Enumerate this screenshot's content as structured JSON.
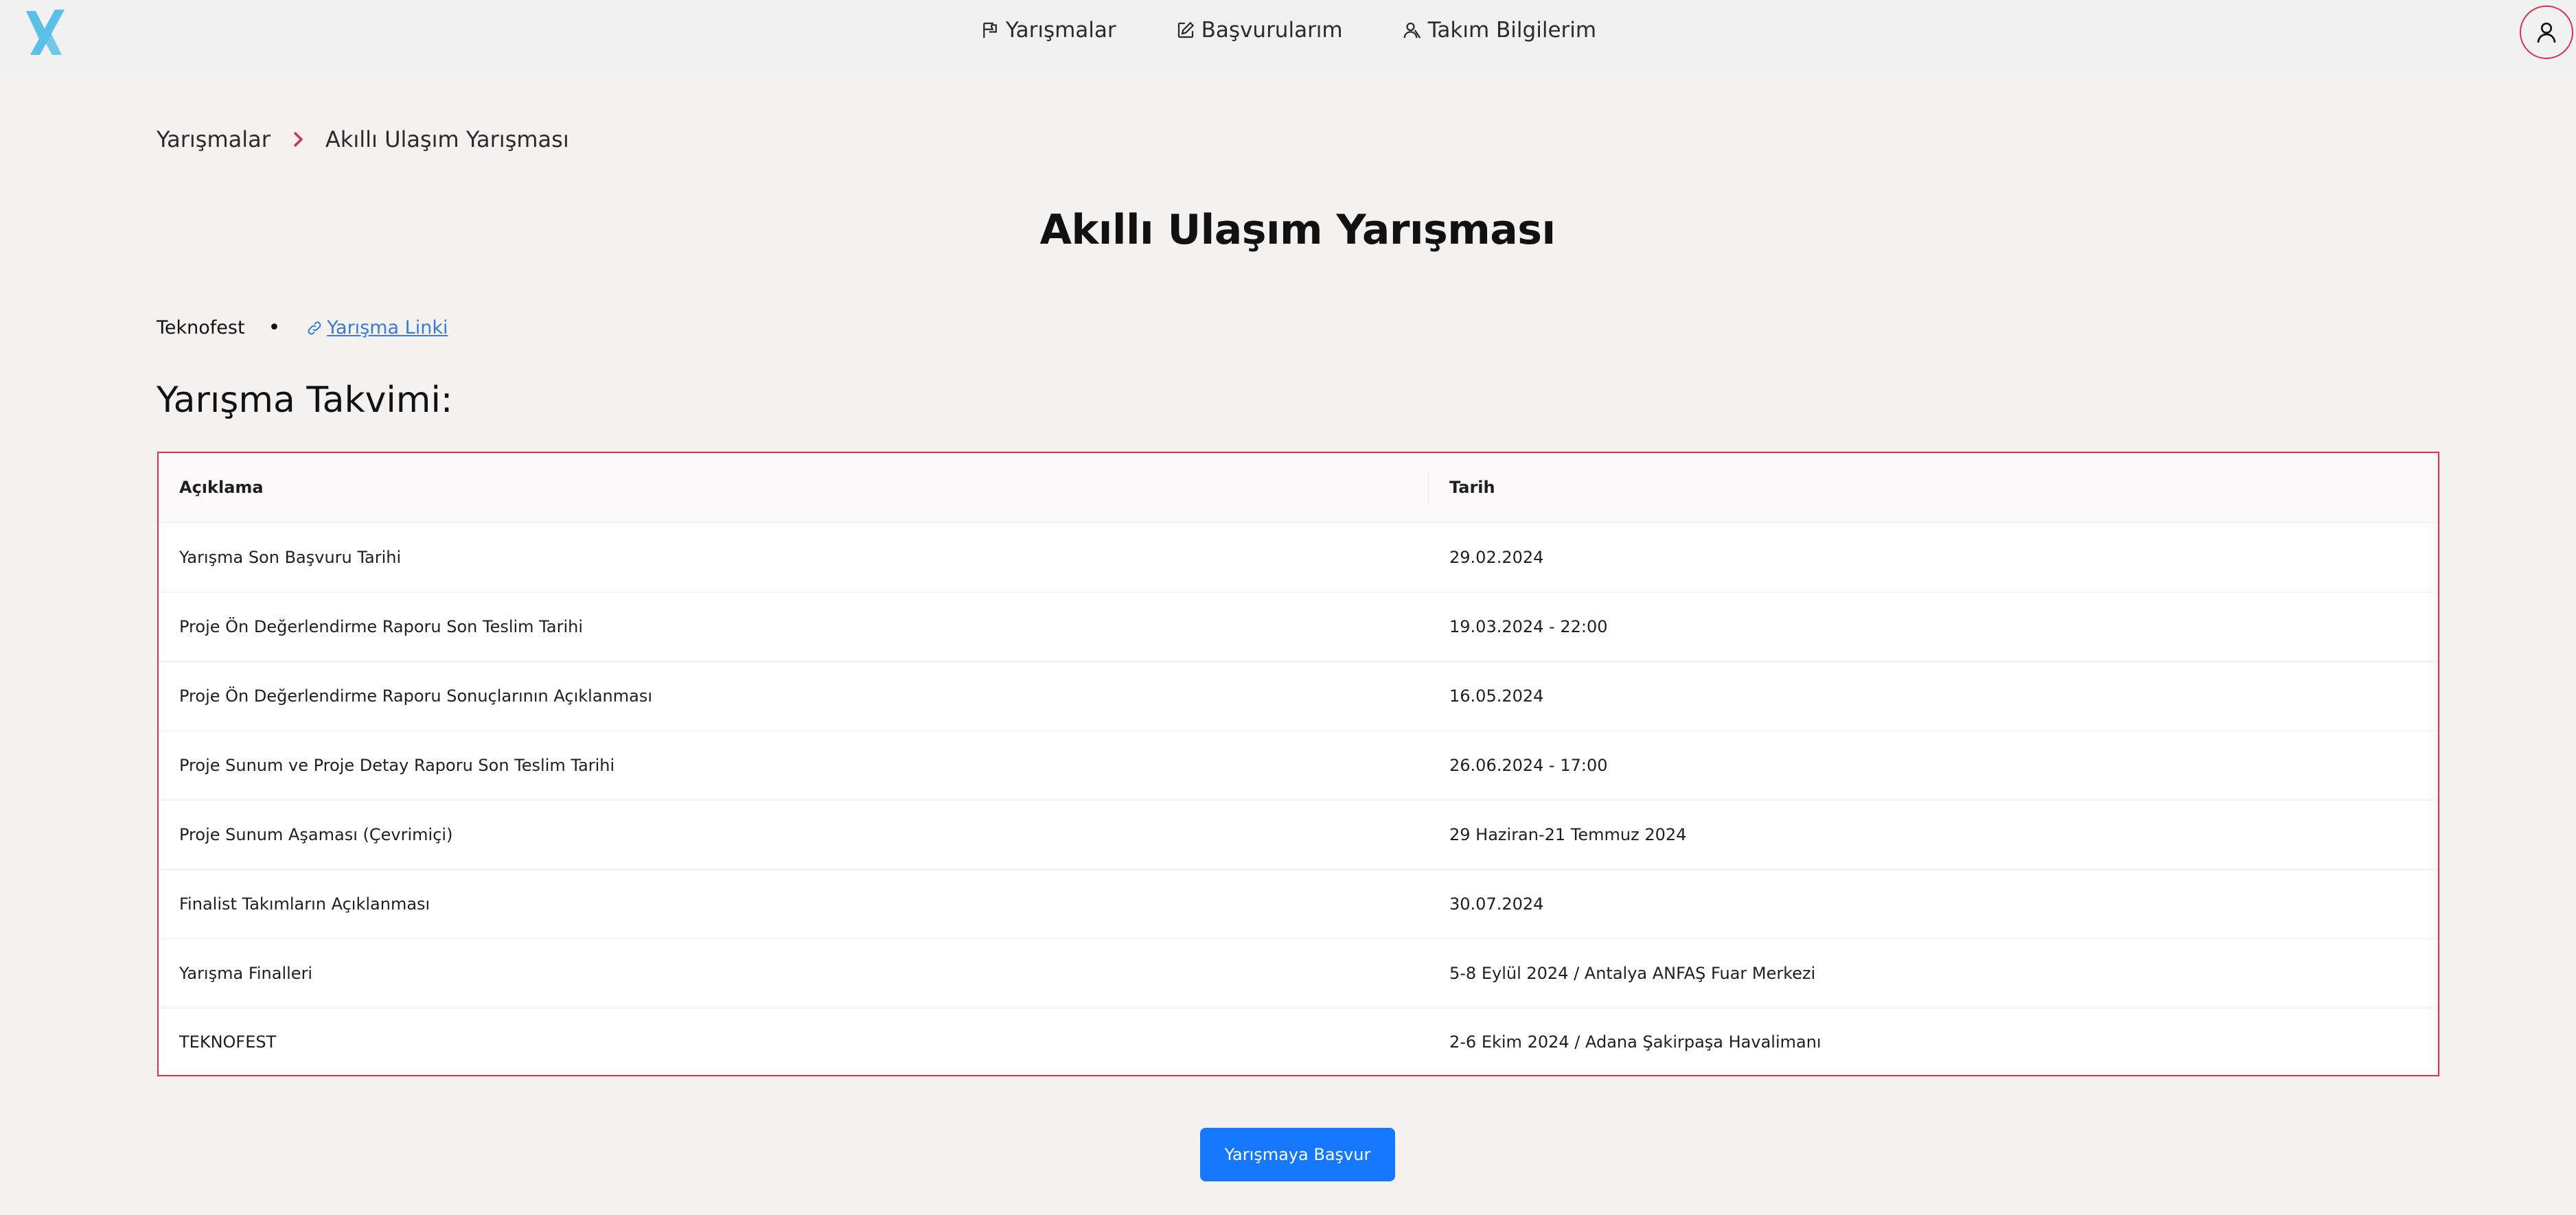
{
  "nav": {
    "items": [
      {
        "label": "Yarışmalar",
        "icon": "flag-icon"
      },
      {
        "label": "Başvurularım",
        "icon": "edit-icon"
      },
      {
        "label": "Takım Bilgilerim",
        "icon": "team-icon"
      }
    ]
  },
  "breadcrumb": {
    "root": "Yarışmalar",
    "current": "Akıllı Ulaşım Yarışması"
  },
  "page": {
    "title": "Akıllı Ulaşım Yarışması",
    "organization": "Teknofest",
    "link_label": "Yarışma Linki",
    "schedule_heading": "Yarışma Takvimi:"
  },
  "schedule": {
    "columns": [
      "Açıklama",
      "Tarih"
    ],
    "rows": [
      [
        "Yarışma Son Başvuru Tarihi",
        "29.02.2024"
      ],
      [
        "Proje Ön Değerlendirme Raporu Son Teslim Tarihi",
        "19.03.2024 - 22:00"
      ],
      [
        "Proje Ön Değerlendirme Raporu Sonuçlarının Açıklanması",
        "16.05.2024"
      ],
      [
        "Proje Sunum ve Proje Detay Raporu Son Teslim Tarihi",
        "26.06.2024 - 17:00"
      ],
      [
        "Proje Sunum Aşaması (Çevrimiçi)",
        "29 Haziran-21 Temmuz 2024"
      ],
      [
        "Finalist Takımların Açıklanması",
        "30.07.2024"
      ],
      [
        "Yarışma Finalleri",
        "5-8 Eylül 2024 / Antalya ANFAŞ Fuar Merkezi"
      ],
      [
        "TEKNOFEST",
        "2-6 Ekim 2024 / Adana Şakirpaşa Havalimanı"
      ]
    ]
  },
  "actions": {
    "apply_label": "Yarışmaya Başvur"
  },
  "colors": {
    "accent": "#d9304f",
    "primary_button": "#1677ff",
    "link": "#3a7bd5",
    "logo": "#5bbfe6"
  }
}
